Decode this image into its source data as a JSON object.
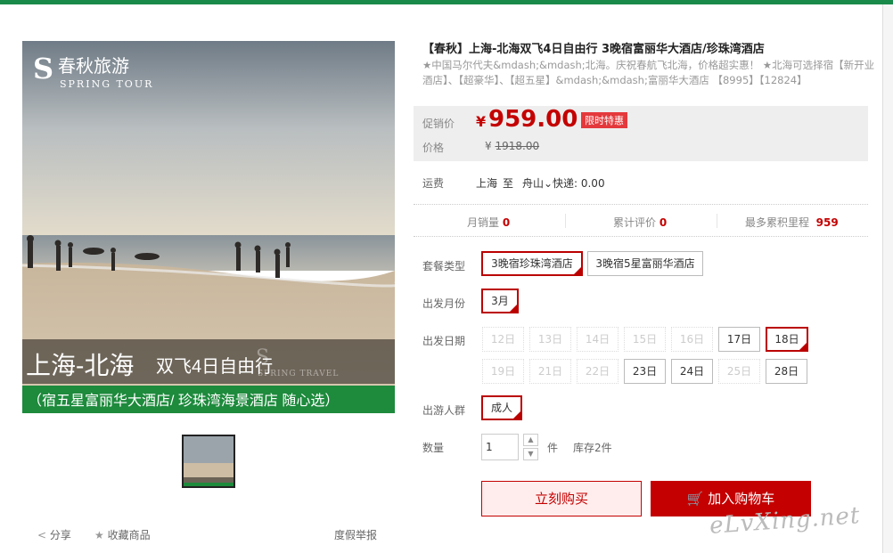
{
  "product": {
    "title": "【春秋】上海-北海双飞4日自由行 3晚宿富丽华大酒店/珍珠湾酒店",
    "subtitle": "★中国马尔代夫&mdash;&mdash;北海。庆祝春航飞北海，价格超实惠！ ★北海可选择宿【新开业酒店】、【超豪华】、【超五星】&mdash;&mdash;富丽华大酒店 【8995】【12824】"
  },
  "image": {
    "logo_cn": "春秋旅游",
    "logo_en": "SPRING TOUR",
    "headline": "上海-北海",
    "headline2": "双飞4日自由行",
    "banner": "（宿五星富丽华大酒店/ 珍珠湾海景酒店 随心选）",
    "wm_en": "SPRING TRAVEL"
  },
  "price": {
    "promo_label": "促销价",
    "currency": "¥",
    "promo_value": "959.00",
    "tag": "限时特惠",
    "orig_label": "价格",
    "orig_value": "1918.00"
  },
  "shipping": {
    "label": "运费",
    "from": "上海",
    "to_word": "至",
    "to": "舟山",
    "method": "快递: 0.00"
  },
  "stats": {
    "monthly_label": "月销量",
    "monthly_value": "0",
    "reviews_label": "累计评价",
    "reviews_value": "0",
    "miles_label": "最多累积里程",
    "miles_value": "959"
  },
  "options": {
    "package_label": "套餐类型",
    "packages": [
      "3晚宿珍珠湾酒店",
      "3晚宿5星富丽华酒店"
    ],
    "month_label": "出发月份",
    "month": "3月",
    "date_label": "出发日期",
    "dates_row1": [
      "12日",
      "13日",
      "14日",
      "15日",
      "16日",
      "17日",
      "18日"
    ],
    "dates_row2": [
      "19日",
      "21日",
      "22日",
      "23日",
      "24日",
      "25日",
      "28日"
    ],
    "people_label": "出游人群",
    "people": "成人",
    "qty_label": "数量",
    "qty_value": "1",
    "qty_unit": "件",
    "stock": "库存2件"
  },
  "buttons": {
    "buy": "立刻购买",
    "cart": "加入购物车"
  },
  "left_actions": {
    "share": "分享",
    "favorite": "收藏商品",
    "report": "度假举报"
  },
  "watermark": "eLvXing.net",
  "colors": {
    "accent": "#c40000",
    "topbar": "#1a8a4a",
    "banner_green": "#1d8a3c"
  }
}
